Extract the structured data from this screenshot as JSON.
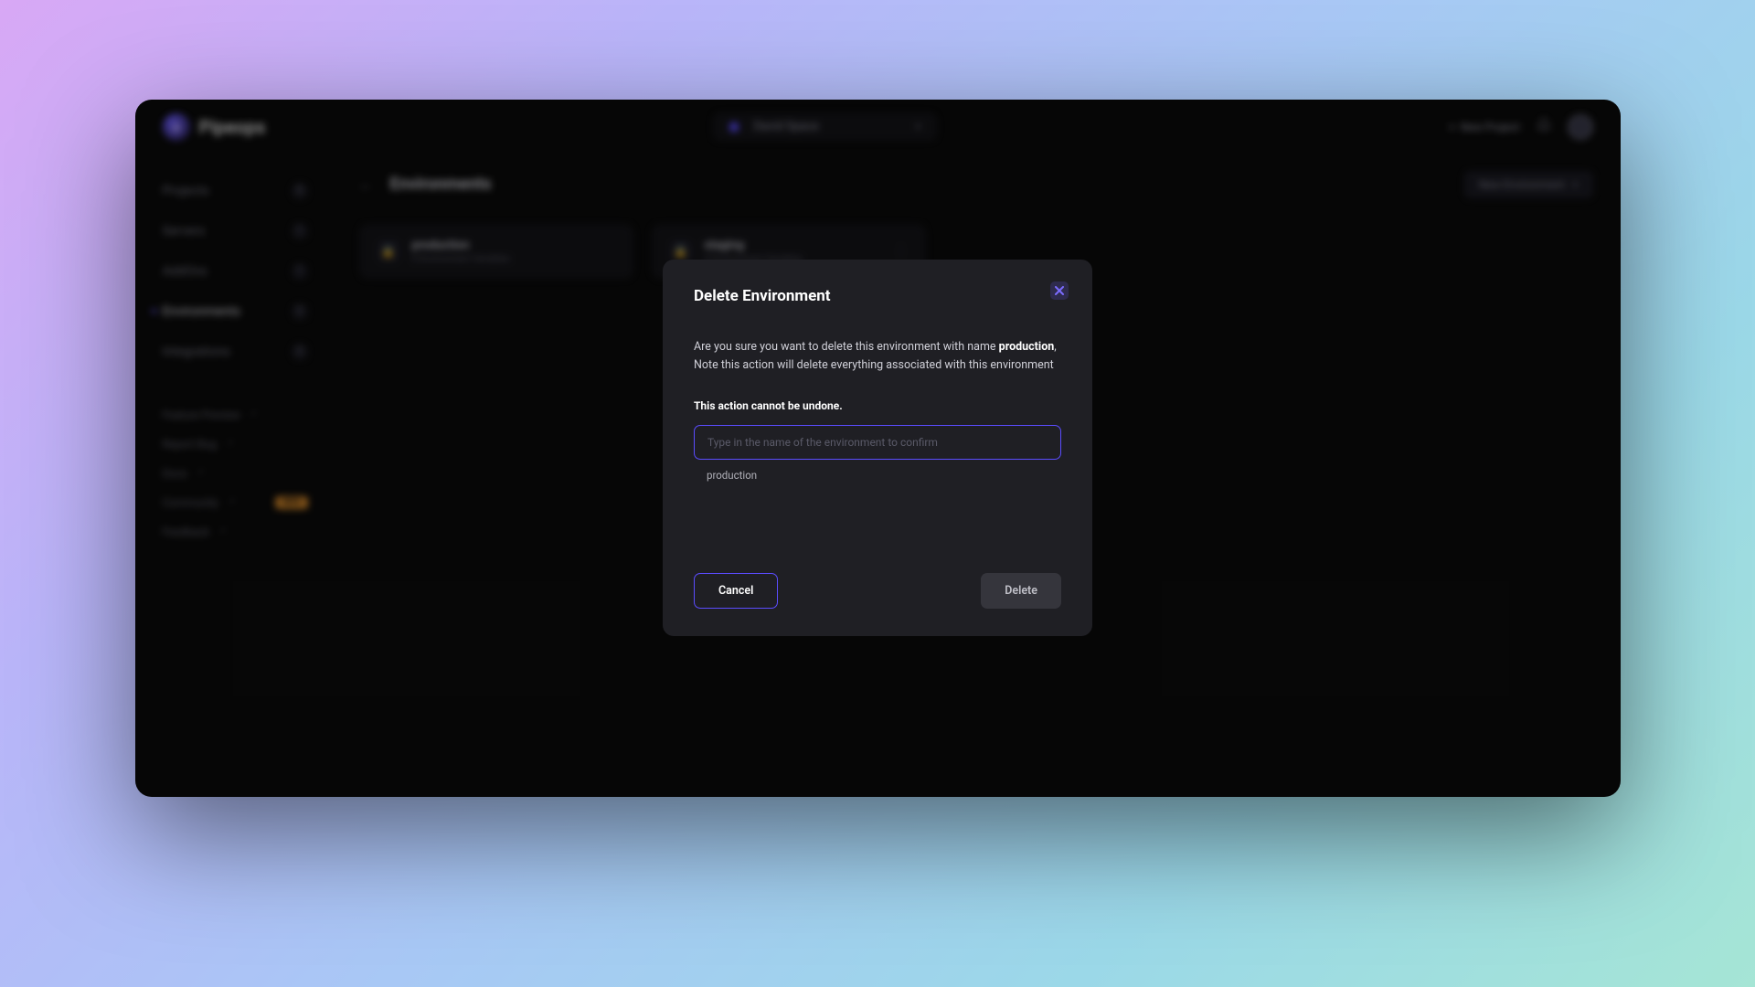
{
  "brand": "Pipeops",
  "space": {
    "name": "David Space"
  },
  "topbar": {
    "new_project": "New Project"
  },
  "sidebar": {
    "items": [
      {
        "label": "Projects",
        "count": "5"
      },
      {
        "label": "Servers",
        "count": "1"
      },
      {
        "label": "AddOns",
        "count": "1"
      },
      {
        "label": "Environments",
        "count": "2"
      },
      {
        "label": "Integrations",
        "count": "3"
      }
    ],
    "lower": [
      {
        "label": "Feature Preview"
      },
      {
        "label": "Report Bug"
      },
      {
        "label": "Docs"
      },
      {
        "label": "Community",
        "badge": "NEW"
      },
      {
        "label": "Feedback"
      }
    ]
  },
  "main": {
    "title": "Environments",
    "new_env": "New Environment",
    "cards": [
      {
        "name": "production",
        "sub": "0 Environment Variables"
      },
      {
        "name": "staging",
        "sub": "0 Environment Variables"
      }
    ]
  },
  "modal": {
    "title": "Delete Environment",
    "text_prefix": "Are you sure you want to delete this environment with name ",
    "env_name": "production",
    "text_suffix": ", Note this action will delete everything associated with this environment",
    "warning": "This action cannot be undone.",
    "placeholder": "Type in the name of the environment to confirm",
    "hint": "production",
    "cancel": "Cancel",
    "delete": "Delete"
  }
}
